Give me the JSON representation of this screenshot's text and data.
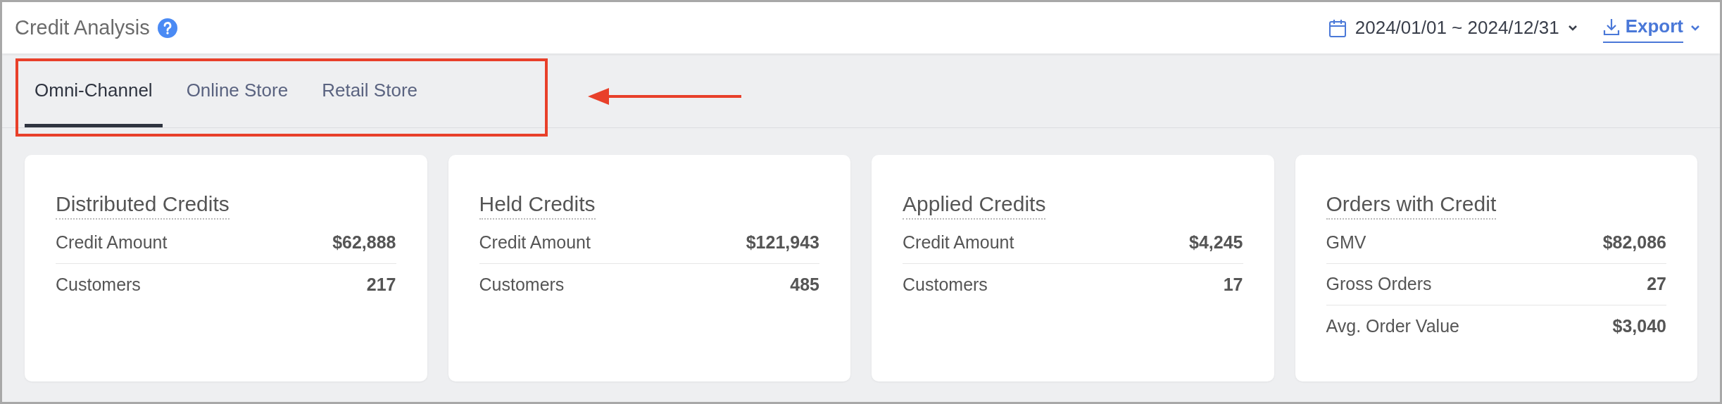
{
  "header": {
    "title": "Credit Analysis",
    "date_range": "2024/01/01 ~ 2024/12/31",
    "export": "Export"
  },
  "tabs": [
    {
      "label": "Omni-Channel",
      "selected": true
    },
    {
      "label": "Online Store",
      "selected": false
    },
    {
      "label": "Retail Store",
      "selected": false
    }
  ],
  "cards": [
    {
      "title": "Distributed Credits",
      "rows": [
        {
          "label": "Credit Amount",
          "value": "$62,888"
        },
        {
          "label": "Customers",
          "value": "217"
        }
      ]
    },
    {
      "title": "Held Credits",
      "rows": [
        {
          "label": "Credit Amount",
          "value": "$121,943"
        },
        {
          "label": "Customers",
          "value": "485"
        }
      ]
    },
    {
      "title": "Applied Credits",
      "rows": [
        {
          "label": "Credit Amount",
          "value": "$4,245"
        },
        {
          "label": "Customers",
          "value": "17"
        }
      ]
    },
    {
      "title": "Orders with Credit",
      "rows": [
        {
          "label": "GMV",
          "value": "$82,086"
        },
        {
          "label": "Gross Orders",
          "value": "27"
        },
        {
          "label": "Avg. Order Value",
          "value": "$3,040"
        }
      ]
    }
  ]
}
